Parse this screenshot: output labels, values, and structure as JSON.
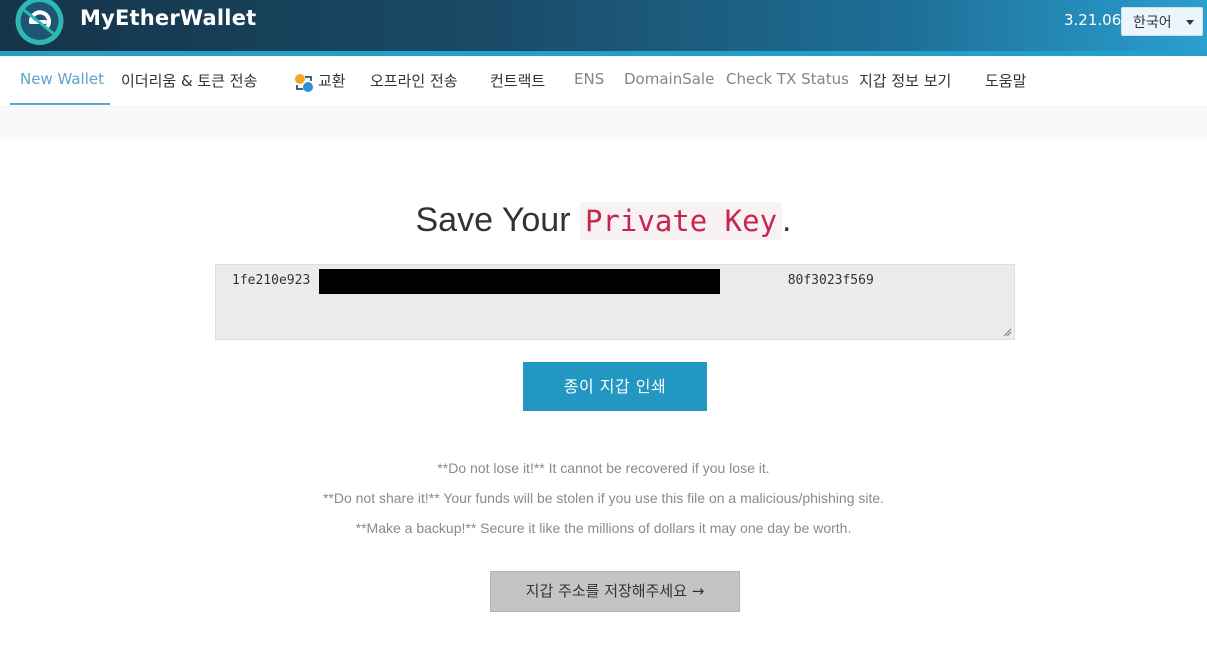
{
  "header": {
    "brand": "MyEtherWallet",
    "version": "3.21.06",
    "language": "한국어"
  },
  "nav": {
    "items": [
      {
        "label": "New Wallet"
      },
      {
        "label": "이더리움 & 토큰 전송"
      },
      {
        "label": "교환"
      },
      {
        "label": "오프라인 전송"
      },
      {
        "label": "컨트랙트"
      },
      {
        "label": "ENS"
      },
      {
        "label": "DomainSale"
      },
      {
        "label": "Check TX Status"
      },
      {
        "label": "지갑 정보 보기"
      },
      {
        "label": "도움말"
      }
    ]
  },
  "main": {
    "title_prefix": "Save Your ",
    "title_code": "Private Key",
    "title_suffix": ".",
    "private_key": "1fe210e923                                                             80f3023f569",
    "print_button": "종이 지갑 인쇄",
    "warnings": [
      "**Do not lose it!** It cannot be recovered if you lose it.",
      "**Do not share it!** Your funds will be stolen if you use this file on a malicious/phishing site.",
      "**Make a backup!** Secure it like the millions of dollars it may one day be worth."
    ],
    "save_button": "지갑 주소를 저장해주세요 →"
  },
  "colors": {
    "accent": "#2197c2",
    "code": "#c7254e",
    "nav_active": "#5aa5c8"
  },
  "icons": {
    "logo": "myetherwallet-logo-icon",
    "swap": "swap-icon",
    "language_caret": "caret-down-icon",
    "resize": "resize-grip-icon"
  }
}
